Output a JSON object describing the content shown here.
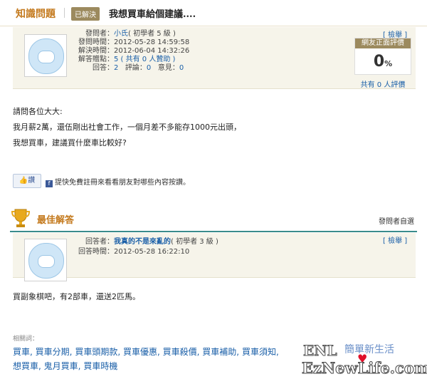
{
  "header": {
    "category": "知識問題",
    "status_badge": "已解決",
    "title": "我想買車給個建議...."
  },
  "question": {
    "report": "[ 檢舉 ]",
    "asker_label": "發問者：",
    "asker_name": "小氏",
    "asker_level": "( 初學者 5 級 )",
    "ask_time_label": "發問時間：",
    "ask_time": "2012-05-28 14:59:58",
    "solve_time_label": "解決時間：",
    "solve_time": "2012-06-04 14:32:26",
    "points_label": "解答贈點：",
    "points": "5 ( 共有 0 人贊助 )",
    "answers_label": "回答：",
    "answers": "2",
    "comments_label": "評論：",
    "comments": "0",
    "opinions_label": "意見：",
    "opinions": "0",
    "rating_header": "網友正面評價",
    "rating_value": "0",
    "rating_unit": "%",
    "rating_count": "共有 0 人評價",
    "body_lines": [
      "請問各位大大:",
      "我月薪2萬，還伍剛出社會工作，一個月差不多能存1000元出頭，",
      "我想買車，建議買什麼車比較好?"
    ],
    "like_label": "讚",
    "fb_text": "提快免費註冊來看看朋友對哪些內容按讚。"
  },
  "best_answer": {
    "title": "最佳解答",
    "chosen_by": "發問者自選",
    "report": "[ 檢舉 ]",
    "answerer_label": "回答者：",
    "answerer_name": "我真的不是來亂的",
    "answerer_level": "( 初學者 3 級 )",
    "answer_time_label": "回答時間：",
    "answer_time": "2012-05-28 16:22:10",
    "body": "買副象棋吧，有2部車，還送2匹馬。"
  },
  "related": {
    "label": "相關詞：",
    "tags": [
      "買車",
      "買車分期",
      "買車頭期款",
      "買車優惠",
      "買車殺價",
      "買車補助",
      "買車須知",
      "想買車",
      "鬼月買車",
      "買車時機"
    ]
  },
  "watermark": {
    "logo": "ENL",
    "slogan": "簡單新生活",
    "site": "EzNewLife.com"
  },
  "colors": {
    "accent": "#c47a1e",
    "link": "#1a5fa8",
    "teal_rule": "#3a8c8c",
    "panel_bg": "#f6f4ea",
    "badge_bg": "#9c8a5e"
  }
}
